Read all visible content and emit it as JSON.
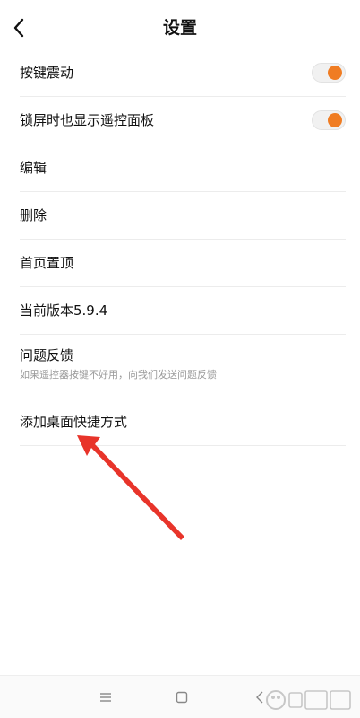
{
  "header": {
    "title": "设置"
  },
  "settings": {
    "vibration": {
      "label": "按键震动",
      "enabled": true
    },
    "lockscreen_panel": {
      "label": "锁屏时也显示遥控面板",
      "enabled": true
    },
    "edit": {
      "label": "编辑"
    },
    "delete": {
      "label": "删除"
    },
    "pin_top": {
      "label": "首页置顶"
    },
    "version": {
      "label": "当前版本5.9.4"
    },
    "feedback": {
      "label": "问题反馈",
      "sub": "如果遥控器按键不好用，向我们发送问题反馈"
    },
    "shortcut": {
      "label": "添加桌面快捷方式"
    }
  },
  "colors": {
    "accent": "#f07c22",
    "annotation": "#e8342a"
  },
  "icons": {
    "back": "chevron-left-icon",
    "menu": "menu-icon",
    "home": "home-square-icon",
    "nav_back": "nav-back-icon"
  }
}
